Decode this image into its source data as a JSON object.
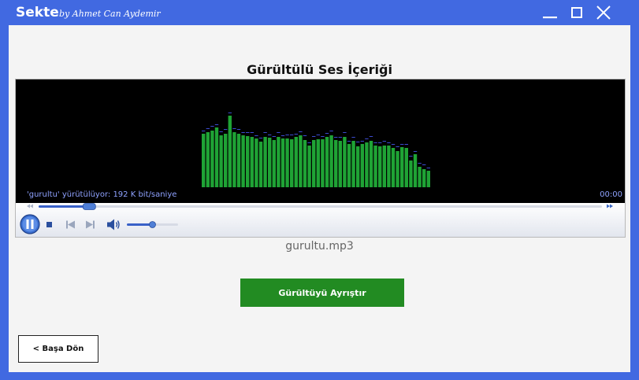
{
  "window": {
    "app_title": "Sekte",
    "app_subtitle": "by Ahmet Can Aydemir",
    "minimize_label": "minimize",
    "maximize_label": "maximize",
    "close_label": "close"
  },
  "heading": "Gürültülü Ses İçeriği",
  "player": {
    "status_text": "'gurultu' yürütülüyor: 192 K bit/saniye",
    "time_text": "00:00",
    "seek_progress": 0.09,
    "volume_level": 0.5,
    "icons": [
      "play-pause-icon",
      "stop-icon",
      "previous-icon",
      "next-icon",
      "volume-icon",
      "rewind-icon",
      "fast-forward-icon"
    ],
    "spectrum": [
      68,
      70,
      72,
      76,
      66,
      68,
      91,
      70,
      68,
      66,
      65,
      64,
      62,
      58,
      64,
      63,
      60,
      64,
      62,
      62,
      61,
      64,
      66,
      60,
      53,
      60,
      61,
      61,
      64,
      66,
      60,
      59,
      64,
      55,
      59,
      52,
      55,
      57,
      59,
      53,
      52,
      53,
      53,
      50,
      46,
      51,
      50,
      34,
      42,
      26,
      23,
      21
    ],
    "colors": {
      "bar": "#1fa335",
      "peak": "#3c4bd0",
      "text": "#8fa2ff",
      "background": "#000000"
    }
  },
  "filename": "gurultu.mp3",
  "actions": {
    "analyze_label": "Gürültüyü Ayrıştır",
    "back_label": "< Başa Dön"
  },
  "colors": {
    "accent": "#4169e1",
    "primary_button": "#228b22"
  }
}
